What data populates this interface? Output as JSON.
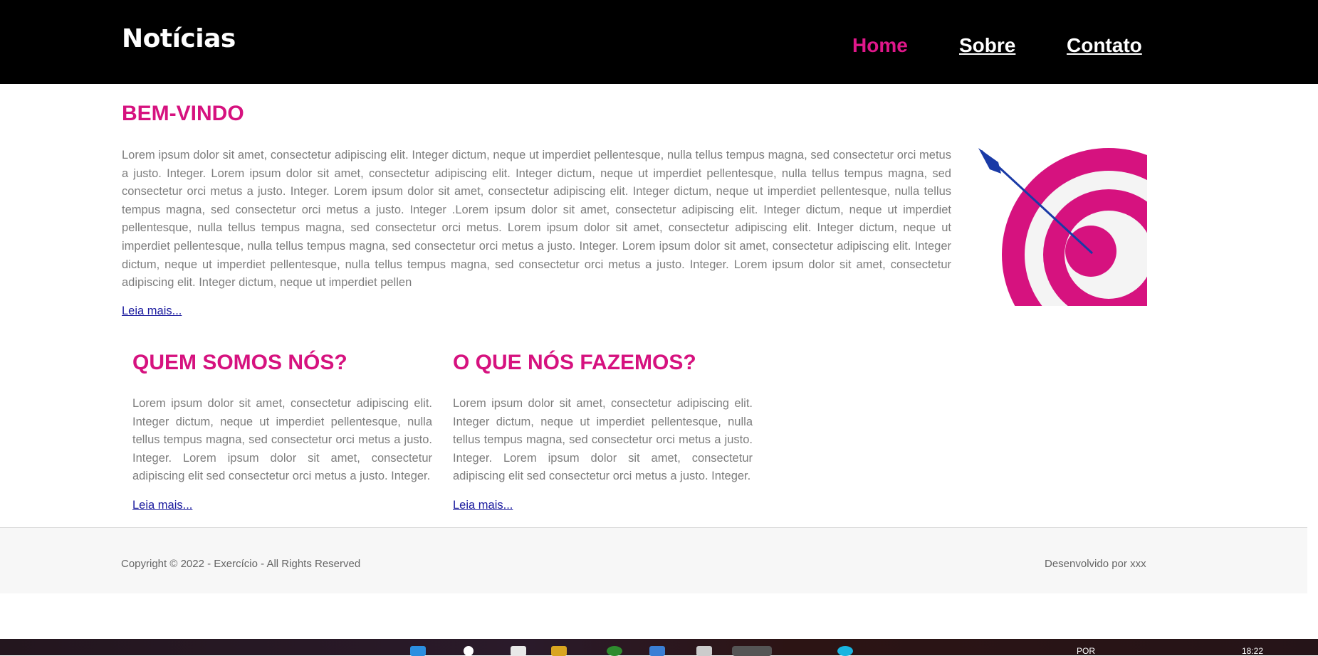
{
  "header": {
    "brand": "Notícias",
    "nav": [
      {
        "label": "Home",
        "active": true
      },
      {
        "label": "Sobre",
        "active": false
      },
      {
        "label": "Contato",
        "active": false
      }
    ]
  },
  "welcome": {
    "title": "BEM-VINDO",
    "text": "Lorem ipsum dolor sit amet, consectetur adipiscing elit. Integer dictum, neque ut imperdiet pellentesque, nulla tellus tempus magna, sed consectetur orci metus a justo. Integer. Lorem ipsum dolor sit amet, consectetur adipiscing elit. Integer dictum, neque ut imperdiet pellentesque, nulla tellus tempus magna, sed consectetur orci metus a justo. Integer. Lorem ipsum dolor sit amet, consectetur adipiscing elit. Integer dictum, neque ut imperdiet pellentesque, nulla tellus tempus magna, sed consectetur orci metus a justo. Integer .Lorem ipsum dolor sit amet, consectetur adipiscing elit. Integer dictum, neque ut imperdiet pellentesque, nulla tellus tempus magna, sed consectetur orci metus. Lorem ipsum dolor sit amet, consectetur adipiscing elit. Integer dictum, neque ut imperdiet pellentesque, nulla tellus tempus magna, sed consectetur orci metus a justo. Integer. Lorem ipsum dolor sit amet, consectetur adipiscing elit. Integer dictum, neque ut imperdiet pellentesque, nulla tellus tempus magna, sed consectetur orci metus a justo. Integer. Lorem ipsum dolor sit amet, consectetur adipiscing elit. Integer dictum, neque ut imperdiet pellen",
    "more": "Leia mais...",
    "image_icon": "target-arrow-icon"
  },
  "sections": [
    {
      "title": "QUEM SOMOS NÓS?",
      "text": "Lorem ipsum dolor sit amet, consectetur adipiscing elit. Integer dictum, neque ut imperdiet pellentesque, nulla tellus tempus magna, sed consectetur orci metus a justo. Integer. Lorem ipsum dolor sit amet, consectetur adipiscing elit sed consectetur orci metus a justo. Integer.",
      "more": "Leia mais..."
    },
    {
      "title": "O QUE NÓS FAZEMOS?",
      "text": "Lorem ipsum dolor sit amet, consectetur adipiscing elit. Integer dictum, neque ut imperdiet pellentesque, nulla tellus tempus magna, sed consectetur orci metus a justo. Integer. Lorem ipsum dolor sit amet, consectetur adipiscing elit sed consectetur orci metus a justo. Integer.",
      "more": "Leia mais..."
    }
  ],
  "footer": {
    "copyright": "Copyright © 2022 - Exercício - All Rights Reserved",
    "credit": "Desenvolvido por xxx"
  },
  "taskbar": {
    "lang": "POR",
    "time": "18:22"
  },
  "colors": {
    "accent": "#d6127f",
    "nav_active": "#e0178a",
    "header_bg": "#000000",
    "link": "#1a1a9e",
    "body_text": "#7d7d7d"
  }
}
